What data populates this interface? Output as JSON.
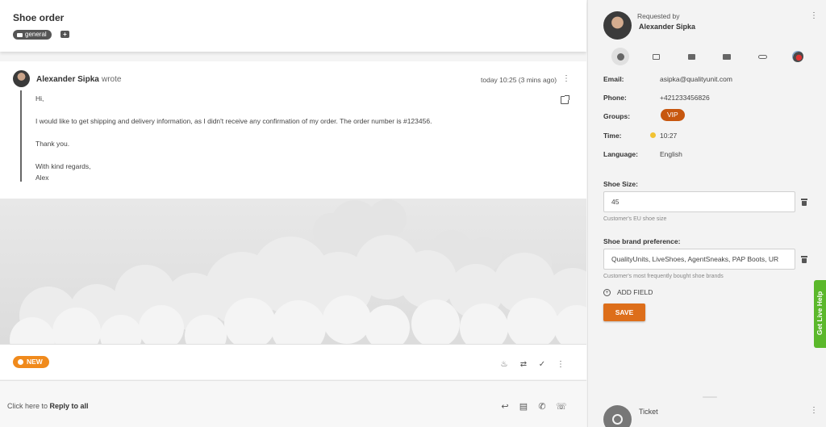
{
  "ticket": {
    "title": "Shoe order",
    "tag": "general"
  },
  "message": {
    "author": "Alexander Sipka",
    "wrote": "wrote",
    "time": "today 10:25 (3 mins ago)",
    "lines": [
      "Hi,",
      "I would like to get shipping and delivery information, as I didn't receive any confirmation of my order. The order number is #123456.",
      "Thank you.",
      "With kind regards,",
      "Alex"
    ]
  },
  "status": {
    "label": "NEW",
    "color": "#f08a1c"
  },
  "reply": {
    "prefix": "Click here to ",
    "action": "Reply to all"
  },
  "contact": {
    "requested_by_label": "Requested by",
    "name": "Alexander Sipka",
    "tabs": [
      "contact-icon",
      "calendar-icon",
      "ticket-icon",
      "mail-icon",
      "link-icon",
      "app-icon"
    ],
    "email_label": "Email:",
    "email": "asipka@qualityunit.com",
    "phone_label": "Phone:",
    "phone": "+421233456826",
    "groups_label": "Groups:",
    "group": "VIP",
    "time_label": "Time:",
    "time": "10:27",
    "language_label": "Language:",
    "language": "English"
  },
  "fields": {
    "shoe_size_label": "Shoe Size:",
    "shoe_size_value": "45",
    "shoe_size_help": "Customer's EU shoe size",
    "brand_label": "Shoe brand preference:",
    "brand_value": "QualityUnits, LiveShoes, AgentSneaks, PAP Boots, UR",
    "brand_help": "Customer's most frequently bought shoe brands",
    "add_field": "ADD FIELD",
    "save": "SAVE"
  },
  "ticket_section": {
    "label": "Ticket"
  },
  "live_help": "Get Live Help",
  "colors": {
    "accent": "#dd6e1a",
    "vip": "#c7570f",
    "live_help": "#5bb82b"
  }
}
